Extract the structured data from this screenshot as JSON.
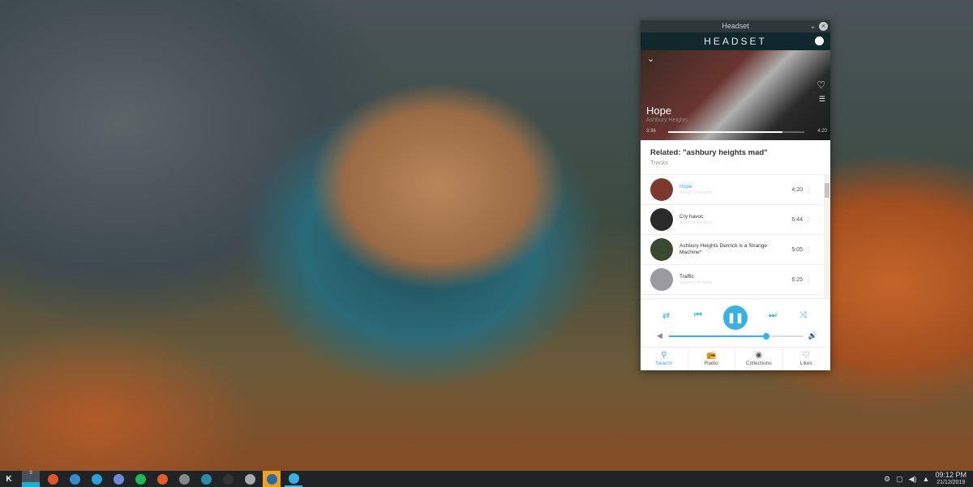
{
  "window": {
    "title": "Headset",
    "brand": "HEADSET"
  },
  "now_playing": {
    "title": "Hope",
    "artist": "Ashbury Heights",
    "elapsed": "3:36",
    "total": "4:20",
    "progress": 0.84
  },
  "related": {
    "heading": "Related: \"ashbury heights mad\"",
    "subheading": "Tracks"
  },
  "tracks": [
    {
      "title": "Hope",
      "artist": "Ashbury Heights",
      "duration": "4:20",
      "active": true,
      "color": "#7a3a30"
    },
    {
      "title": "Cry havoc",
      "artist": "Ashbury Heights",
      "duration": "6:44",
      "active": false,
      "color": "#2a2a2a"
    },
    {
      "title": "Ashbury Heights Denrick is a Strange Machine*",
      "artist": "",
      "duration": "5:05",
      "active": false,
      "color": "#3a4a30"
    },
    {
      "title": "Traffic",
      "artist": "Ashbury Heights",
      "duration": "6:25",
      "active": false,
      "color": "#9a9aa0"
    }
  ],
  "player": {
    "volume": 0.72,
    "accent": "#3ab0e0"
  },
  "tabs": [
    {
      "label": "Search",
      "icon": "search-icon"
    },
    {
      "label": "Radio",
      "icon": "radio-icon"
    },
    {
      "label": "Collections",
      "icon": "disc-icon"
    },
    {
      "label": "Likes",
      "icon": "heart-icon"
    }
  ],
  "taskbar": {
    "desktop_number": "9",
    "time": "09:12 PM",
    "date": "21/12/2019",
    "apps": [
      {
        "name": "brave",
        "color": "#e0552a"
      },
      {
        "name": "thunderbird",
        "color": "#3a8ad0"
      },
      {
        "name": "telegram",
        "color": "#2aa0d8"
      },
      {
        "name": "discord",
        "color": "#7289da"
      },
      {
        "name": "spotify",
        "color": "#1db954"
      },
      {
        "name": "pocket-casts",
        "color": "#e85a2a"
      },
      {
        "name": "archive",
        "color": "#888"
      },
      {
        "name": "kdenlive",
        "color": "#2a8ab0"
      },
      {
        "name": "terminal",
        "color": "#333"
      },
      {
        "name": "files",
        "color": "#aaa"
      },
      {
        "name": "steam",
        "color": "#2a6aa0"
      },
      {
        "name": "headset",
        "color": "#3ab0e0"
      }
    ]
  }
}
